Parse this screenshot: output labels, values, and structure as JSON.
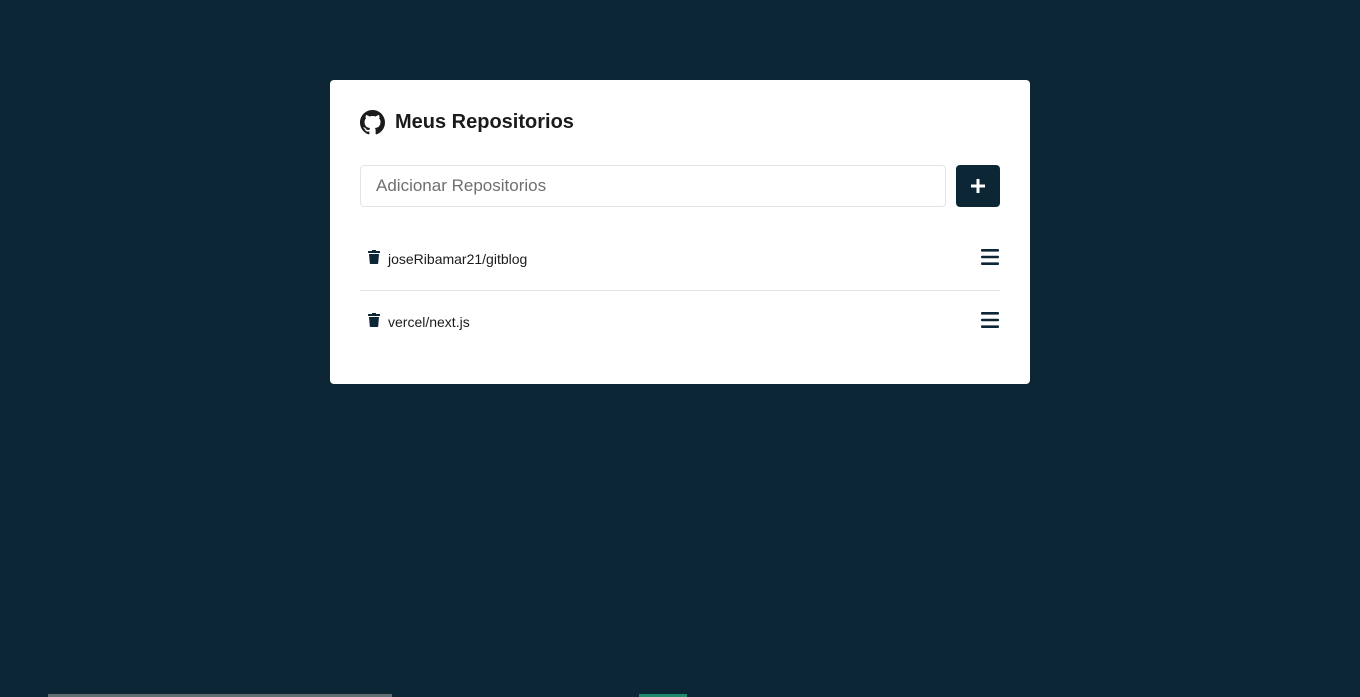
{
  "header": {
    "title": "Meus Repositorios",
    "icon": "github-icon"
  },
  "form": {
    "input_placeholder": "Adicionar Repositorios",
    "input_value": "",
    "add_button_icon": "plus-icon"
  },
  "repositories": [
    {
      "name": "joseRibamar21/gitblog",
      "delete_icon": "trash-icon",
      "details_icon": "menu-icon"
    },
    {
      "name": "vercel/next.js",
      "delete_icon": "trash-icon",
      "details_icon": "menu-icon"
    }
  ],
  "colors": {
    "background": "#0d2636",
    "card": "#ffffff",
    "accent": "#0d2636",
    "text": "#1b1b1b"
  }
}
